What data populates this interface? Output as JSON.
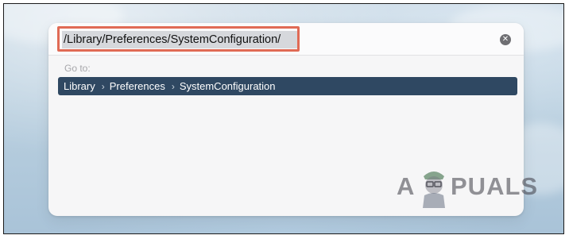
{
  "dialog": {
    "path_value": "/Library/Preferences/SystemConfiguration/",
    "goto_label": "Go to:",
    "clear_icon": "xmark-circle-icon",
    "result": {
      "crumbs": [
        "Library",
        "Preferences",
        "SystemConfiguration"
      ],
      "separator": "›"
    }
  },
  "watermark": {
    "left_text": "A",
    "right_text": "PUALS"
  },
  "colors": {
    "highlight_border": "#e06a55",
    "result_row_bg": "#2f4862",
    "dialog_bg": "#f6f6f7",
    "input_selection_bg": "#d6d8dc"
  }
}
